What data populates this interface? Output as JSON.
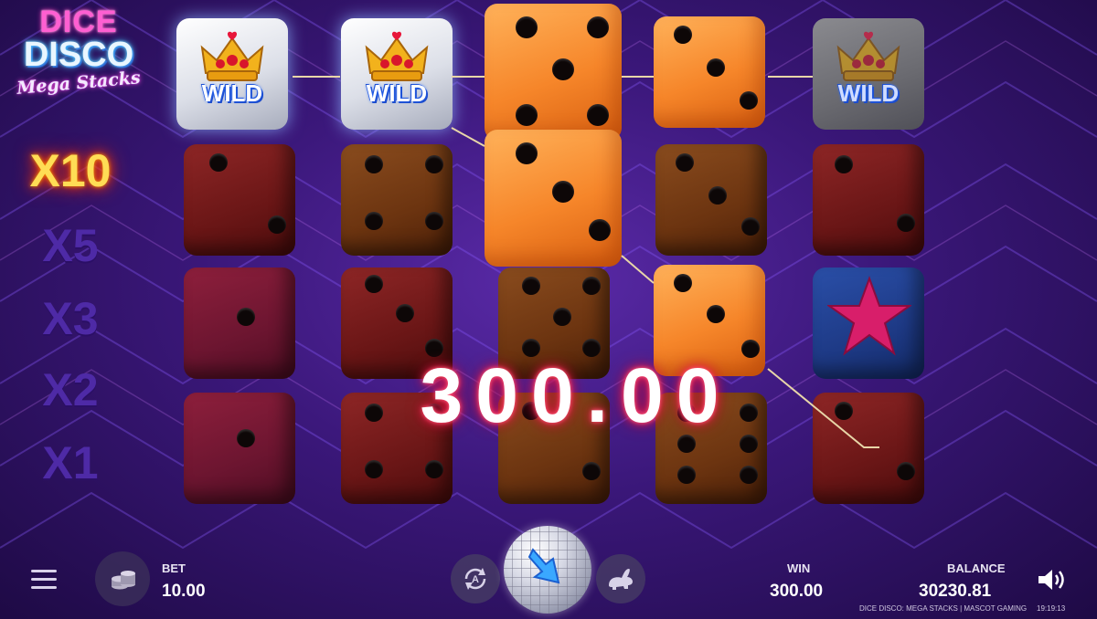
{
  "logo": {
    "line1": "DICE",
    "line2": "DISCO",
    "line3": "Mega Stacks"
  },
  "multipliers": [
    {
      "label": "X10",
      "active": true
    },
    {
      "label": "X5",
      "active": false
    },
    {
      "label": "X3",
      "active": false
    },
    {
      "label": "X2",
      "active": false
    },
    {
      "label": "X1",
      "active": false
    }
  ],
  "grid": {
    "wild_label": "WILD",
    "reels": [
      [
        "wild",
        "dark-red 2",
        "crimson 1",
        "crimson 1"
      ],
      [
        "wild",
        "dark-brown 4",
        "dark-red 3",
        "dark-red 4"
      ],
      [
        "orange 5",
        "orange 3",
        "dark-brown 5",
        "dark-brown 2"
      ],
      [
        "dark-brown 3",
        "dark-brown 3",
        "orange 3",
        "dark-brown 6"
      ],
      [
        "wild (dim)",
        "dark-red 2",
        "star",
        "dark-red 2"
      ]
    ]
  },
  "win_display": "300.00",
  "bottom_bar": {
    "bet_label": "BET",
    "bet_value": "10.00",
    "win_label": "WIN",
    "win_value": "300.00",
    "balance_label": "BALANCE",
    "balance_value": "30230.81",
    "footer_text": "DICE DISCO: MEGA STACKS | MASCOT GAMING",
    "clock": "19:19:13"
  },
  "colors": {
    "active_multiplier": "#ffdd55",
    "inactive_multiplier": "#4e2aa6",
    "win_glow": "#ff2a55"
  }
}
